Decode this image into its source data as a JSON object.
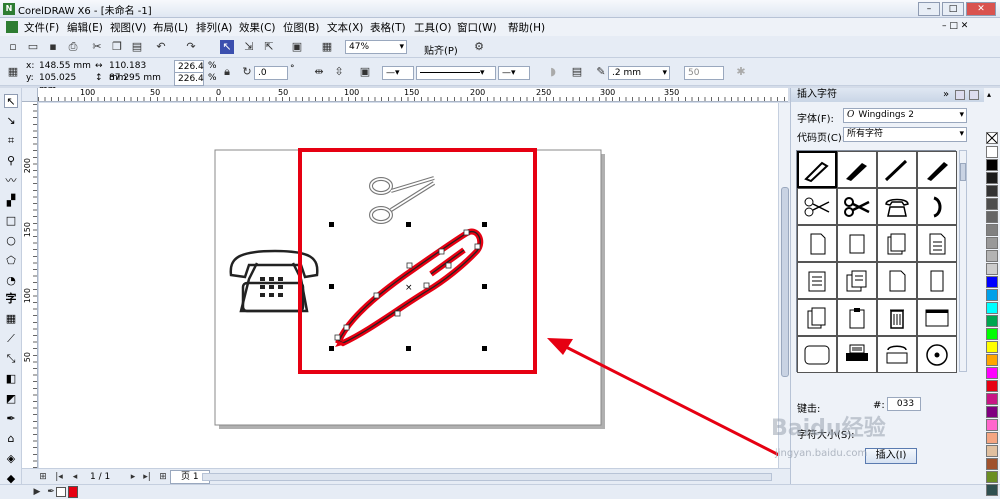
{
  "window": {
    "title": "CorelDRAW X6 - [未命名 -1]",
    "app_icon": "corel-logo-icon"
  },
  "menu": [
    "文件(F)",
    "编辑(E)",
    "视图(V)",
    "布局(L)",
    "排列(A)",
    "效果(C)",
    "位图(B)",
    "文本(X)",
    "表格(T)",
    "工具(O)",
    "窗口(W)",
    "帮助(H)"
  ],
  "standard_toolbar": {
    "zoom": "47%",
    "snap_label": "贴齐(P)"
  },
  "property_bar": {
    "x": "148.55 mm",
    "y": "105.025 mm",
    "width": "110.183 mm",
    "height": "87.295 mm",
    "scale_x": "226.4",
    "scale_y": "226.4",
    "percent": "%",
    "angle": ".0",
    "angle_unit": "°",
    "outline_width": ".2 mm",
    "transparency": "50"
  },
  "ruler": {
    "h_ticks": [
      "100",
      "50",
      "0",
      "50",
      "100",
      "150",
      "200",
      "250",
      "300",
      "350"
    ],
    "v_ticks": [
      "200",
      "150",
      "100",
      "50"
    ]
  },
  "page_nav": {
    "counter": "1 / 1",
    "tab": "页 1"
  },
  "docker": {
    "title": "插入字符",
    "font_label": "字体(F):",
    "font_value": "Wingdings 2",
    "codepage_label": "代码页(C):",
    "codepage_value": "所有字符",
    "keystroke_label": "键击:",
    "hash_label": "#:",
    "code_value": "033",
    "size_label": "字符大小(S):",
    "insert_button": "插入(I)"
  },
  "watermark": {
    "brand": "Baidu经验",
    "url": "jingyan.baidu.com"
  },
  "colors": {
    "accent": "#e60012",
    "selection": "#e60012",
    "pen": "#e60012"
  },
  "palette": [
    "#ffffff",
    "#000000",
    "#1a1a1a",
    "#333333",
    "#4d4d4d",
    "#666666",
    "#808080",
    "#999999",
    "#b3b3b3",
    "#cccccc",
    "#0000ff",
    "#00a0e9",
    "#00ffff",
    "#00a650",
    "#00ff00",
    "#ffff00",
    "#ffa500",
    "#ff00ff",
    "#e60012",
    "#c71585",
    "#800080",
    "#ff66cc",
    "#f4a582",
    "#e0c0a0",
    "#a0522d",
    "#6b8e23",
    "#2f4f4f"
  ]
}
